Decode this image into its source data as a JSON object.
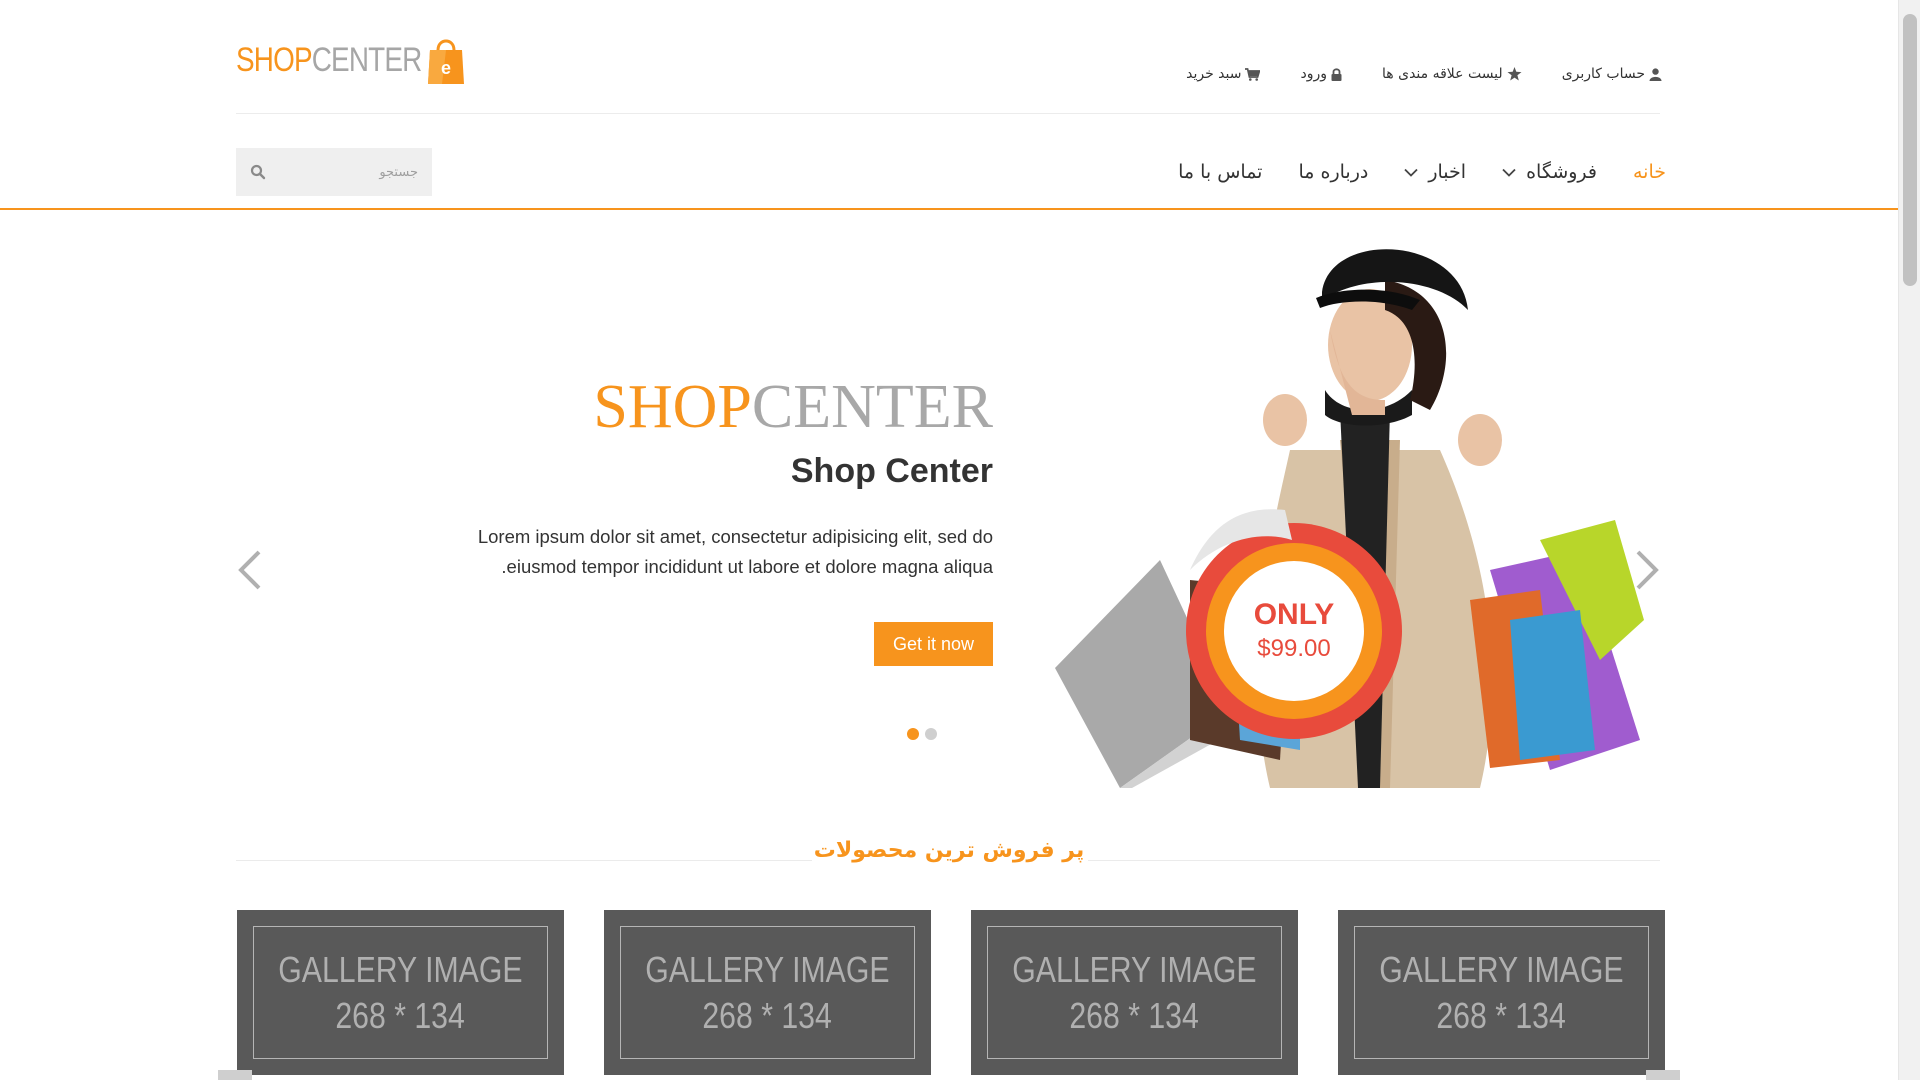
{
  "header": {
    "logo": {
      "part1": "SHOP",
      "part2": "CENTER",
      "badge": "e"
    },
    "userbar": [
      {
        "label": "حساب کاربری",
        "icon": "user-icon"
      },
      {
        "label": "لیست علاقه مندی ها",
        "icon": "star-icon"
      },
      {
        "label": "ورود",
        "icon": "lock-icon"
      },
      {
        "label": "سبد خرید",
        "icon": "cart-icon"
      }
    ]
  },
  "nav": {
    "items": [
      {
        "label": "خانه",
        "active": true,
        "dropdown": false
      },
      {
        "label": "فروشگاه",
        "active": false,
        "dropdown": true
      },
      {
        "label": "اخبار",
        "active": false,
        "dropdown": true
      },
      {
        "label": "درباره ما",
        "active": false,
        "dropdown": false
      },
      {
        "label": "تماس با ما",
        "active": false,
        "dropdown": false
      }
    ],
    "search_placeholder": "جستجو"
  },
  "slider": {
    "title_part1": "SHOP",
    "title_part2": "CENTER",
    "heading": "Shop Center",
    "text": "Lorem ipsum dolor sit amet, consectetur adipisicing elit, sed do eiusmod tempor incididunt ut labore et dolore magna aliqua.",
    "button": "Get it now",
    "badge_label": "ONLY",
    "badge_price": "$99.00",
    "slide_count": 2,
    "active_slide": 1
  },
  "best_sellers": {
    "title": "پر فروش ترین محصولات",
    "items": [
      {
        "line1": "GALLERY IMAGE",
        "line2": "268 * 134"
      },
      {
        "line1": "GALLERY IMAGE",
        "line2": "268 * 134"
      },
      {
        "line1": "GALLERY IMAGE",
        "line2": "268 * 134"
      },
      {
        "line1": "GALLERY IMAGE",
        "line2": "268 * 134"
      }
    ]
  },
  "colors": {
    "accent": "#f7941d",
    "muted": "#a6a6a6",
    "text": "#333333",
    "gallery": "#595959"
  }
}
